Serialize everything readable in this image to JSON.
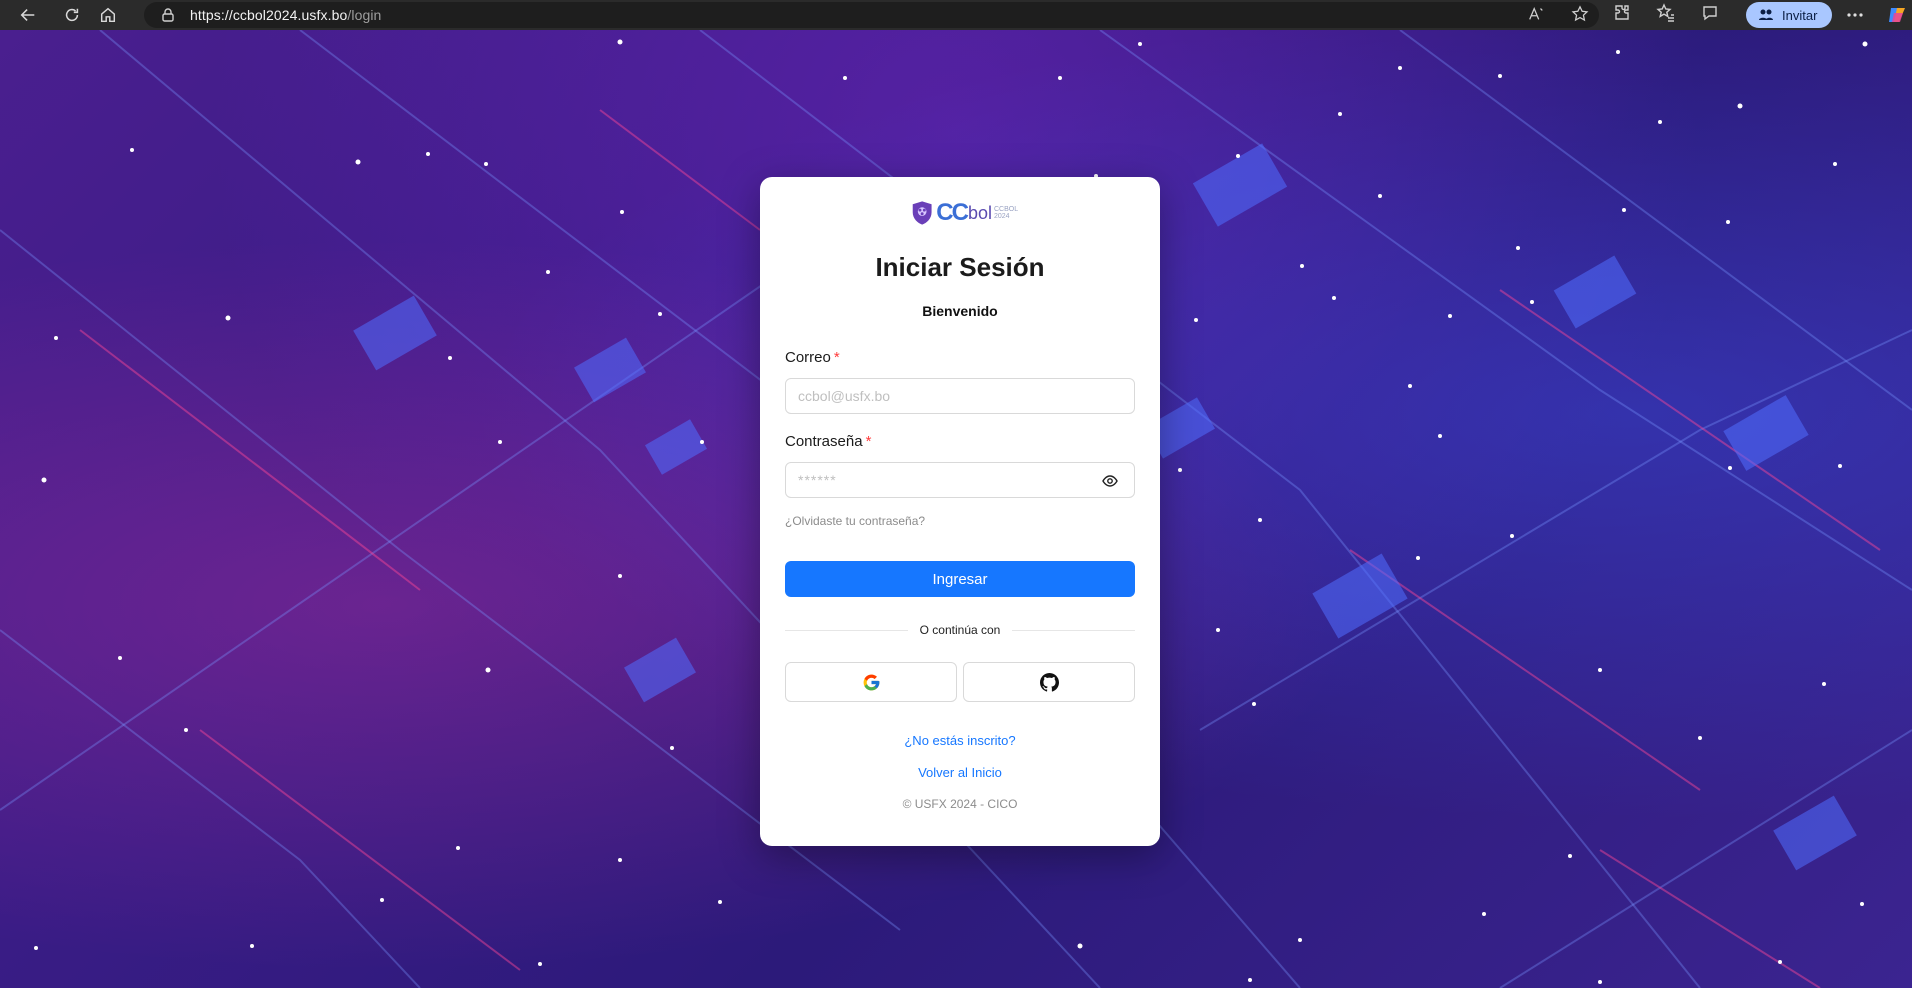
{
  "browser": {
    "url_host": "https://ccbol2024.usfx.bo",
    "url_path": "/login",
    "invite_label": "Invitar"
  },
  "logo": {
    "cc": "CC",
    "bol": "bol",
    "year_line1": "CCBOL",
    "year_line2": "2024"
  },
  "login": {
    "title": "Iniciar Sesión",
    "subtitle": "Bienvenido",
    "email_label": "Correo",
    "required_mark": "*",
    "email_placeholder": "ccbol@usfx.bo",
    "password_label": "Contraseña",
    "password_placeholder": "******",
    "forgot_link": "¿Olvidaste tu contraseña?",
    "submit_label": "Ingresar",
    "divider_text": "O continúa con",
    "signup_link": "¿No estás inscrito?",
    "home_link": "Volver al Inicio",
    "footer": "© USFX 2024 - CICO"
  },
  "colors": {
    "primary": "#1677ff",
    "required": "#ff3b3b",
    "chrome_bg": "#2b2b2b",
    "invite_bg": "#a9c7ff"
  },
  "icons": [
    "back-icon",
    "refresh-icon",
    "home-icon",
    "lock-icon",
    "read-aloud-icon",
    "favorite-star-icon",
    "extensions-icon",
    "favorites-icon",
    "chat-icon",
    "more-icon",
    "copilot-icon",
    "eye-icon",
    "google-icon",
    "github-icon",
    "shield-logo-icon"
  ]
}
